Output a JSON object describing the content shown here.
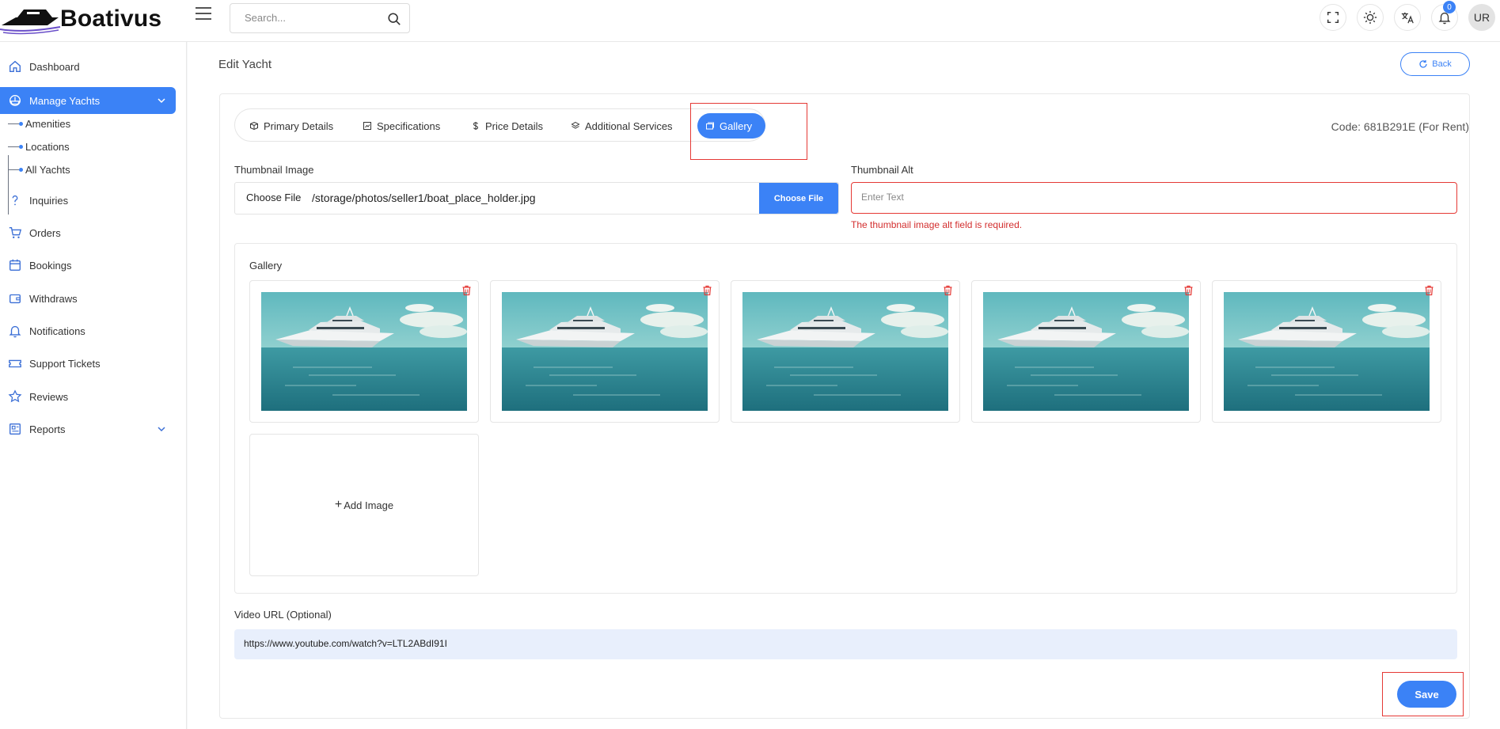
{
  "app": {
    "brand": "Boativus"
  },
  "header": {
    "search_placeholder": "Search...",
    "notification_count": "0",
    "avatar_initials": "UR"
  },
  "sidebar": {
    "items": [
      {
        "label": "Dashboard",
        "icon": "home-icon"
      },
      {
        "label": "Manage Yachts",
        "icon": "yacht-icon",
        "active": true
      },
      {
        "label": "Inquiries",
        "icon": "question-icon"
      },
      {
        "label": "Orders",
        "icon": "cart-icon"
      },
      {
        "label": "Bookings",
        "icon": "calendar-icon"
      },
      {
        "label": "Withdraws",
        "icon": "wallet-icon"
      },
      {
        "label": "Notifications",
        "icon": "bell-icon"
      },
      {
        "label": "Support Tickets",
        "icon": "ticket-icon"
      },
      {
        "label": "Reviews",
        "icon": "star-icon"
      },
      {
        "label": "Reports",
        "icon": "report-icon"
      }
    ],
    "sub_items": [
      "Amenities",
      "Locations",
      "All Yachts"
    ]
  },
  "page": {
    "title": "Edit Yacht",
    "back_label": "Back",
    "code": "Code: 681B291E (For Rent)"
  },
  "tabs": [
    {
      "label": "Primary Details"
    },
    {
      "label": "Specifications"
    },
    {
      "label": "Price Details"
    },
    {
      "label": "Additional Services"
    },
    {
      "label": "Gallery",
      "active": true
    }
  ],
  "form": {
    "thumbnail_label": "Thumbnail Image",
    "file_native_label": "Choose File",
    "file_path": "/storage/photos/seller1/boat_place_holder.jpg",
    "file_button": "Choose File",
    "alt_label": "Thumbnail Alt",
    "alt_placeholder": "Enter Text",
    "alt_value": "",
    "alt_error": "The thumbnail image alt field is required.",
    "gallery_label": "Gallery",
    "add_image_label": "Add Image",
    "video_label": "Video URL (Optional)",
    "video_value": "https://www.youtube.com/watch?v=LTL2ABdI91I",
    "save_label": "Save"
  },
  "gallery_count": 5,
  "colors": {
    "accent": "#3b82f6",
    "error": "#e53935",
    "sea": "#2f8f9c"
  }
}
